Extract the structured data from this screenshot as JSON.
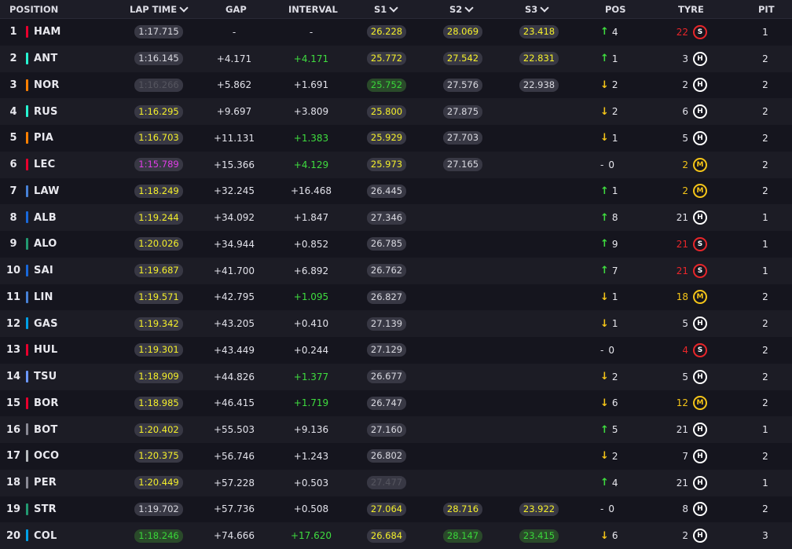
{
  "headers": {
    "position": "POSITION",
    "lap_time": "LAP TIME",
    "gap": "GAP",
    "interval": "INTERVAL",
    "s1": "S1",
    "s2": "S2",
    "s3": "S3",
    "pos": "POS",
    "tyre": "TYRE",
    "pit": "PIT"
  },
  "rows": [
    {
      "pos": "1",
      "code": "HAM",
      "team": "#e8002d",
      "lap": "1:17.715",
      "lapc": "w",
      "gap": "-",
      "intv": "-",
      "intvc": "w",
      "s1": "26.228",
      "s1c": "y",
      "s2": "28.069",
      "s2c": "y",
      "s3": "23.418",
      "s3c": "y",
      "dir": "up",
      "chg": "4",
      "age": "22",
      "agec": "red",
      "tyre": "S",
      "pit": "1"
    },
    {
      "pos": "2",
      "code": "ANT",
      "team": "#27f4d2",
      "lap": "1:16.145",
      "lapc": "w",
      "gap": "+4.171",
      "intv": "+4.171",
      "intvc": "g",
      "s1": "25.772",
      "s1c": "y",
      "s2": "27.542",
      "s2c": "y",
      "s3": "22.831",
      "s3c": "y",
      "dir": "up",
      "chg": "1",
      "age": "3",
      "agec": "wht",
      "tyre": "H",
      "pit": "2"
    },
    {
      "pos": "3",
      "code": "NOR",
      "team": "#ff8000",
      "lap": "1:16.266",
      "lapc": "d",
      "gap": "+5.862",
      "intv": "+1.691",
      "intvc": "w",
      "s1": "25.752",
      "s1c": "g",
      "s2": "27.576",
      "s2c": "w",
      "s3": "22.938",
      "s3c": "w",
      "dir": "down",
      "chg": "2",
      "age": "2",
      "agec": "wht",
      "tyre": "H",
      "pit": "2"
    },
    {
      "pos": "4",
      "code": "RUS",
      "team": "#27f4d2",
      "lap": "1:16.295",
      "lapc": "y",
      "gap": "+9.697",
      "intv": "+3.809",
      "intvc": "w",
      "s1": "25.800",
      "s1c": "y",
      "s2": "27.875",
      "s2c": "w",
      "s3": "",
      "s3c": "",
      "dir": "down",
      "chg": "2",
      "age": "6",
      "agec": "wht",
      "tyre": "H",
      "pit": "2"
    },
    {
      "pos": "5",
      "code": "PIA",
      "team": "#ff8000",
      "lap": "1:16.703",
      "lapc": "y",
      "gap": "+11.131",
      "intv": "+1.383",
      "intvc": "g",
      "s1": "25.929",
      "s1c": "y",
      "s2": "27.703",
      "s2c": "w",
      "s3": "",
      "s3c": "",
      "dir": "down",
      "chg": "1",
      "age": "5",
      "agec": "wht",
      "tyre": "H",
      "pit": "2"
    },
    {
      "pos": "6",
      "code": "LEC",
      "team": "#e8002d",
      "lap": "1:15.789",
      "lapc": "p",
      "gap": "+15.366",
      "intv": "+4.129",
      "intvc": "g",
      "s1": "25.973",
      "s1c": "y",
      "s2": "27.165",
      "s2c": "w",
      "s3": "",
      "s3c": "",
      "dir": "none",
      "chg": "0",
      "age": "2",
      "agec": "yel",
      "tyre": "M",
      "pit": "2"
    },
    {
      "pos": "7",
      "code": "LAW",
      "team": "#4781d7",
      "lap": "1:18.249",
      "lapc": "y",
      "gap": "+32.245",
      "intv": "+16.468",
      "intvc": "w",
      "s1": "26.445",
      "s1c": "w",
      "s2": "",
      "s2c": "",
      "s3": "",
      "s3c": "",
      "dir": "up",
      "chg": "1",
      "age": "2",
      "agec": "yel",
      "tyre": "M",
      "pit": "2"
    },
    {
      "pos": "8",
      "code": "ALB",
      "team": "#1868db",
      "lap": "1:19.244",
      "lapc": "y",
      "gap": "+34.092",
      "intv": "+1.847",
      "intvc": "w",
      "s1": "27.346",
      "s1c": "w",
      "s2": "",
      "s2c": "",
      "s3": "",
      "s3c": "",
      "dir": "up",
      "chg": "8",
      "age": "21",
      "agec": "wht",
      "tyre": "H",
      "pit": "1"
    },
    {
      "pos": "9",
      "code": "ALO",
      "team": "#229971",
      "lap": "1:20.026",
      "lapc": "y",
      "gap": "+34.944",
      "intv": "+0.852",
      "intvc": "w",
      "s1": "26.785",
      "s1c": "w",
      "s2": "",
      "s2c": "",
      "s3": "",
      "s3c": "",
      "dir": "up",
      "chg": "9",
      "age": "21",
      "agec": "red",
      "tyre": "S",
      "pit": "1"
    },
    {
      "pos": "10",
      "code": "SAI",
      "team": "#1868db",
      "lap": "1:19.687",
      "lapc": "y",
      "gap": "+41.700",
      "intv": "+6.892",
      "intvc": "w",
      "s1": "26.762",
      "s1c": "w",
      "s2": "",
      "s2c": "",
      "s3": "",
      "s3c": "",
      "dir": "up",
      "chg": "7",
      "age": "21",
      "agec": "red",
      "tyre": "S",
      "pit": "1"
    },
    {
      "pos": "11",
      "code": "LIN",
      "team": "#4781d7",
      "lap": "1:19.571",
      "lapc": "y",
      "gap": "+42.795",
      "intv": "+1.095",
      "intvc": "g",
      "s1": "26.827",
      "s1c": "w",
      "s2": "",
      "s2c": "",
      "s3": "",
      "s3c": "",
      "dir": "down",
      "chg": "1",
      "age": "18",
      "agec": "yel",
      "tyre": "M",
      "pit": "2"
    },
    {
      "pos": "12",
      "code": "GAS",
      "team": "#00a1e8",
      "lap": "1:19.342",
      "lapc": "y",
      "gap": "+43.205",
      "intv": "+0.410",
      "intvc": "w",
      "s1": "27.139",
      "s1c": "w",
      "s2": "",
      "s2c": "",
      "s3": "",
      "s3c": "",
      "dir": "down",
      "chg": "1",
      "age": "5",
      "agec": "wht",
      "tyre": "H",
      "pit": "2"
    },
    {
      "pos": "13",
      "code": "HUL",
      "team": "#e8002d",
      "lap": "1:19.301",
      "lapc": "y",
      "gap": "+43.449",
      "intv": "+0.244",
      "intvc": "w",
      "s1": "27.129",
      "s1c": "w",
      "s2": "",
      "s2c": "",
      "s3": "",
      "s3c": "",
      "dir": "none",
      "chg": "0",
      "age": "4",
      "agec": "red",
      "tyre": "S",
      "pit": "2"
    },
    {
      "pos": "14",
      "code": "TSU",
      "team": "#6c98ff",
      "lap": "1:18.909",
      "lapc": "y",
      "gap": "+44.826",
      "intv": "+1.377",
      "intvc": "g",
      "s1": "26.677",
      "s1c": "w",
      "s2": "",
      "s2c": "",
      "s3": "",
      "s3c": "",
      "dir": "down",
      "chg": "2",
      "age": "5",
      "agec": "wht",
      "tyre": "H",
      "pit": "2"
    },
    {
      "pos": "15",
      "code": "BOR",
      "team": "#e8002d",
      "lap": "1:18.985",
      "lapc": "y",
      "gap": "+46.415",
      "intv": "+1.719",
      "intvc": "g",
      "s1": "26.747",
      "s1c": "w",
      "s2": "",
      "s2c": "",
      "s3": "",
      "s3c": "",
      "dir": "down",
      "chg": "6",
      "age": "12",
      "agec": "yel",
      "tyre": "M",
      "pit": "2"
    },
    {
      "pos": "16",
      "code": "BOT",
      "team": "#8a8a95",
      "lap": "1:20.402",
      "lapc": "y",
      "gap": "+55.503",
      "intv": "+9.136",
      "intvc": "w",
      "s1": "27.160",
      "s1c": "w",
      "s2": "",
      "s2c": "",
      "s3": "",
      "s3c": "",
      "dir": "up",
      "chg": "5",
      "age": "21",
      "agec": "wht",
      "tyre": "H",
      "pit": "1"
    },
    {
      "pos": "17",
      "code": "OCO",
      "team": "#b6babd",
      "lap": "1:20.375",
      "lapc": "y",
      "gap": "+56.746",
      "intv": "+1.243",
      "intvc": "w",
      "s1": "26.802",
      "s1c": "w",
      "s2": "",
      "s2c": "",
      "s3": "",
      "s3c": "",
      "dir": "down",
      "chg": "2",
      "age": "7",
      "agec": "wht",
      "tyre": "H",
      "pit": "2"
    },
    {
      "pos": "18",
      "code": "PER",
      "team": "#8a8a95",
      "lap": "1:20.449",
      "lapc": "y",
      "gap": "+57.228",
      "intv": "+0.503",
      "intvc": "w",
      "s1": "27.477",
      "s1c": "d",
      "s2": "",
      "s2c": "",
      "s3": "",
      "s3c": "",
      "dir": "up",
      "chg": "4",
      "age": "21",
      "agec": "wht",
      "tyre": "H",
      "pit": "1"
    },
    {
      "pos": "19",
      "code": "STR",
      "team": "#229971",
      "lap": "1:19.702",
      "lapc": "w",
      "gap": "+57.736",
      "intv": "+0.508",
      "intvc": "w",
      "s1": "27.064",
      "s1c": "y",
      "s2": "28.716",
      "s2c": "y",
      "s3": "23.922",
      "s3c": "y",
      "dir": "none",
      "chg": "0",
      "age": "8",
      "agec": "wht",
      "tyre": "H",
      "pit": "2"
    },
    {
      "pos": "20",
      "code": "COL",
      "team": "#00a1e8",
      "lap": "1:18.246",
      "lapc": "g",
      "gap": "+74.666",
      "intv": "+17.620",
      "intvc": "g",
      "s1": "26.684",
      "s1c": "y",
      "s2": "28.147",
      "s2c": "g",
      "s3": "23.415",
      "s3c": "g",
      "dir": "down",
      "chg": "6",
      "age": "2",
      "agec": "wht",
      "tyre": "H",
      "pit": "3"
    }
  ]
}
